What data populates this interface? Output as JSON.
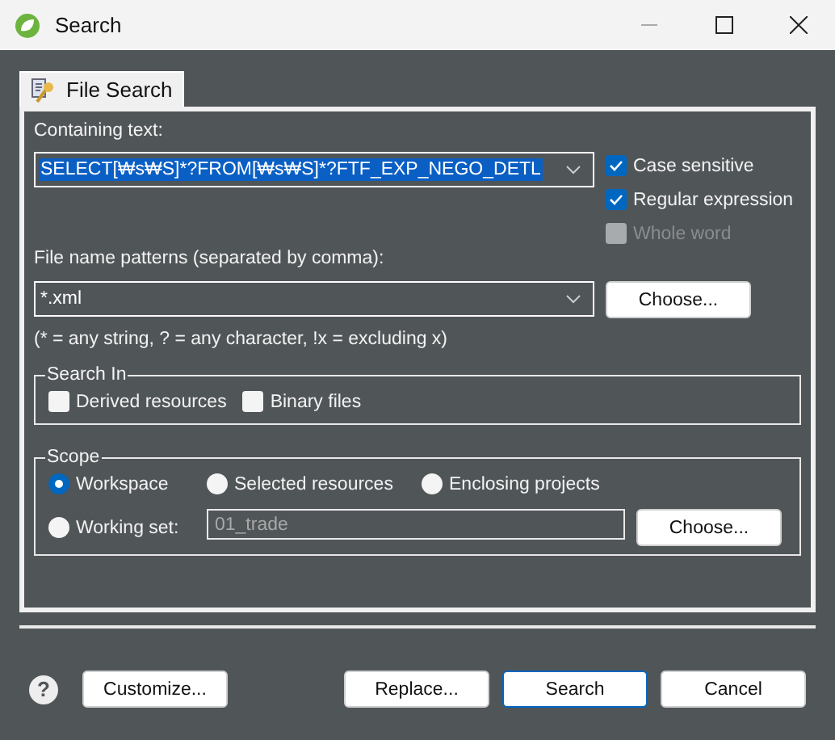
{
  "window": {
    "title": "Search"
  },
  "tabs": [
    {
      "label": "File Search",
      "selected": true
    }
  ],
  "containing_text": {
    "label": "Containing text:",
    "value": "SELECT[₩s₩S]*?FROM[₩s₩S]*?FTF_EXP_NEGO_DETL"
  },
  "options": [
    {
      "label": "Case sensitive",
      "checked": true,
      "disabled": false
    },
    {
      "label": "Regular expression",
      "checked": true,
      "disabled": false
    },
    {
      "label": "Whole word",
      "checked": false,
      "disabled": true
    }
  ],
  "file_patterns": {
    "label": "File name patterns (separated by comma):",
    "value": "*.xml",
    "button": "Choose...",
    "hint": "(* = any string, ? = any character, !x = excluding x)"
  },
  "search_in": {
    "title": "Search In",
    "options": [
      {
        "label": "Derived resources",
        "checked": false
      },
      {
        "label": "Binary files",
        "checked": false
      }
    ]
  },
  "scope": {
    "title": "Scope",
    "options": [
      {
        "label": "Workspace",
        "selected": true
      },
      {
        "label": "Selected resources",
        "selected": false
      },
      {
        "label": "Enclosing projects",
        "selected": false
      },
      {
        "label": "Working set:",
        "selected": false
      }
    ],
    "working_set": "01_trade",
    "button": "Choose..."
  },
  "footer": {
    "help": "?",
    "left_button": "Customize...",
    "buttons": [
      {
        "label": "Replace...",
        "default": false
      },
      {
        "label": "Search",
        "default": true
      },
      {
        "label": "Cancel",
        "default": false
      }
    ]
  }
}
